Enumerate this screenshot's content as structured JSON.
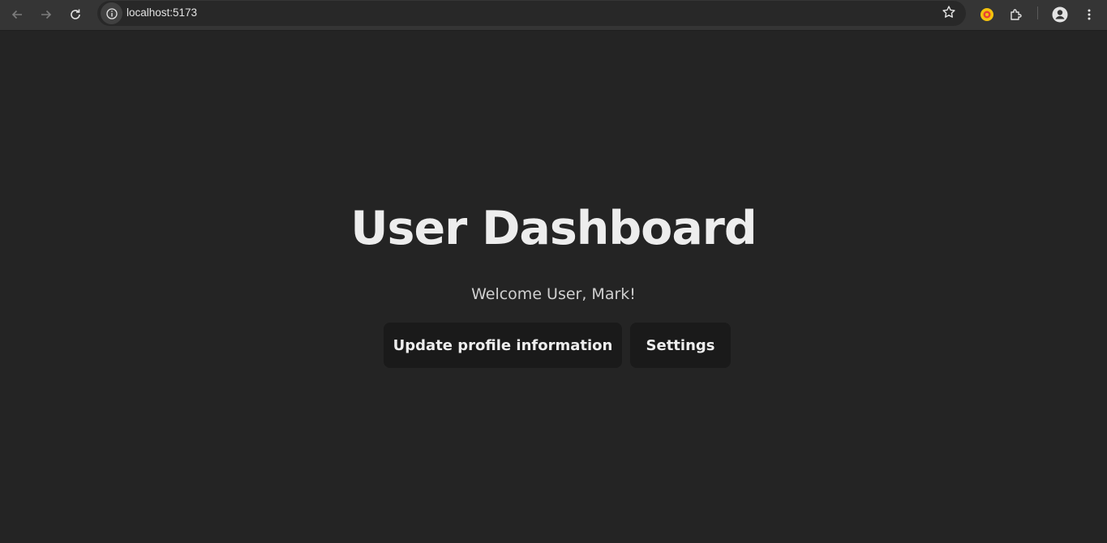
{
  "browser": {
    "url": "localhost:5173",
    "icons": {
      "back": "arrow-left-icon",
      "forward": "arrow-right-icon",
      "reload": "reload-icon",
      "site_info": "info-icon",
      "bookmark": "star-icon",
      "extension": "extension-logo-icon",
      "extensions_menu": "puzzle-icon",
      "profile": "profile-icon",
      "menu": "kebab-menu-icon"
    }
  },
  "page": {
    "title": "User Dashboard",
    "welcome": "Welcome User, Mark!",
    "buttons": {
      "update_profile": "Update profile information",
      "settings": "Settings"
    }
  },
  "colors": {
    "background": "#242424",
    "button_bg": "#1a1a1a",
    "toolbar_bg": "#353535"
  }
}
